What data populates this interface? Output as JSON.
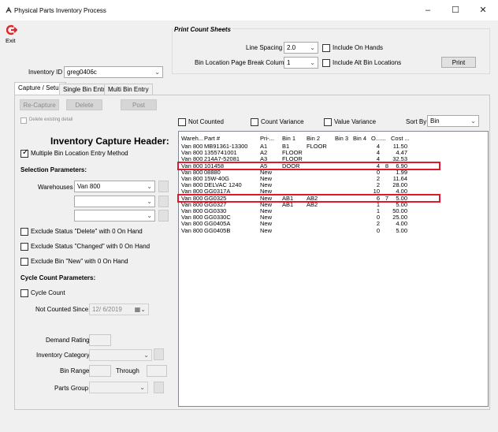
{
  "window": {
    "title": "Physical Parts Inventory Process",
    "minimize": "–",
    "maximize": "☐",
    "close": "✕"
  },
  "toolbar": {
    "exit_label": "Exit"
  },
  "header": {
    "inventory_id_label": "Inventory ID",
    "inventory_id_value": "greg0406c"
  },
  "print_sheets": {
    "title": "Print Count Sheets",
    "line_spacing_label": "Line Spacing",
    "line_spacing_value": "2.0",
    "include_on_hands_label": "Include On Hands",
    "page_break_label": "Bin Location Page Break Column",
    "page_break_value": "1",
    "include_alt_bins_label": "Include Alt Bin Locations",
    "print_button": "Print"
  },
  "tabs": [
    {
      "label": "Capture / Setup"
    },
    {
      "label": "Single Bin Entry"
    },
    {
      "label": "Multi Bin Entry"
    }
  ],
  "actions": {
    "recapture": "Re-Capture",
    "delete": "Delete",
    "post": "Post"
  },
  "left": {
    "delete_existing_label": "Delete existing detail",
    "header_title": "Inventory Capture Header:",
    "multi_bin_label": "Multiple Bin Location Entry Method",
    "selection_params": "Selection Parameters:",
    "warehouses_label": "Warehouses",
    "warehouse_1": "Van 800",
    "warehouse_2": "",
    "warehouse_3": "",
    "exclude_delete": "Exclude Status \"Delete\" with 0 On Hand",
    "exclude_changed": "Exclude Status \"Changed\" with 0 On Hand",
    "exclude_new": "Exclude Bin \"New\" with 0 On Hand",
    "cycle_params": "Cycle Count Parameters:",
    "cycle_count_label": "Cycle Count",
    "not_counted_label": "Not Counted Since",
    "not_counted_value": "12/ 6/2019",
    "demand_rating_label": "Demand Rating",
    "inventory_category_label": "Inventory Category",
    "bin_range_label": "Bin Range",
    "through_label": "Through",
    "parts_group_label": "Parts Group"
  },
  "filters": {
    "not_counted": "Not Counted",
    "count_variance": "Count Variance",
    "value_variance": "Value Variance",
    "sort_by_label": "Sort By",
    "sort_by_value": "Bin"
  },
  "list": {
    "columns": [
      "Wareh...",
      "Part #",
      "Pri-...",
      "Bin 1",
      "Bin 2",
      "Bin 3",
      "Bin 4",
      "O...",
      "...",
      "Cost ..."
    ],
    "rows": [
      [
        "Van 800",
        "MB91361-13300",
        "A1",
        "B1",
        "FLOOR",
        "",
        "",
        "4",
        "",
        "11.50"
      ],
      [
        "Van 800",
        "1355741001",
        "A2",
        "FLOOR",
        "",
        "",
        "",
        "4",
        "",
        "4.47"
      ],
      [
        "Van 800",
        "214A7-52081",
        "A3",
        "FLOOR",
        "",
        "",
        "",
        "4",
        "",
        "32.53"
      ],
      [
        "Van 800",
        "101458",
        "A5",
        "DOOR",
        "",
        "",
        "",
        "4",
        "8",
        "6.90"
      ],
      [
        "Van 800",
        "08880",
        "New",
        "",
        "",
        "",
        "",
        "0",
        "",
        "1.99"
      ],
      [
        "Van 800",
        "15W-40G",
        "New",
        "",
        "",
        "",
        "",
        "2",
        "",
        "11.64"
      ],
      [
        "Van 800",
        "DELVAC 1240",
        "New",
        "",
        "",
        "",
        "",
        "2",
        "",
        "28.00"
      ],
      [
        "Van 800",
        "GG0317A",
        "New",
        "",
        "",
        "",
        "",
        "10",
        "",
        "4.00"
      ],
      [
        "Van 800",
        "GG0325",
        "New",
        "AB1",
        "AB2",
        "",
        "",
        "6",
        "7",
        "5.00"
      ],
      [
        "Van 800",
        "GG0327",
        "New",
        "AB1",
        "AB2",
        "",
        "",
        "1",
        "",
        "5.00"
      ],
      [
        "Van 800",
        "GG0330",
        "New",
        "",
        "",
        "",
        "",
        "1",
        "",
        "50.00"
      ],
      [
        "Van 800",
        "GG0330C",
        "New",
        "",
        "",
        "",
        "",
        "0",
        "",
        "25.00"
      ],
      [
        "Van 800",
        "GG0405A",
        "New",
        "",
        "",
        "",
        "",
        "2",
        "",
        "4.00"
      ],
      [
        "Van 800",
        "GG0405B",
        "New",
        "",
        "",
        "",
        "",
        "0",
        "",
        "5.00"
      ]
    ],
    "highlighted_rows": [
      3,
      8
    ]
  },
  "colors": {
    "highlight": "#e0182d",
    "exit_icon": "#d9262b"
  }
}
